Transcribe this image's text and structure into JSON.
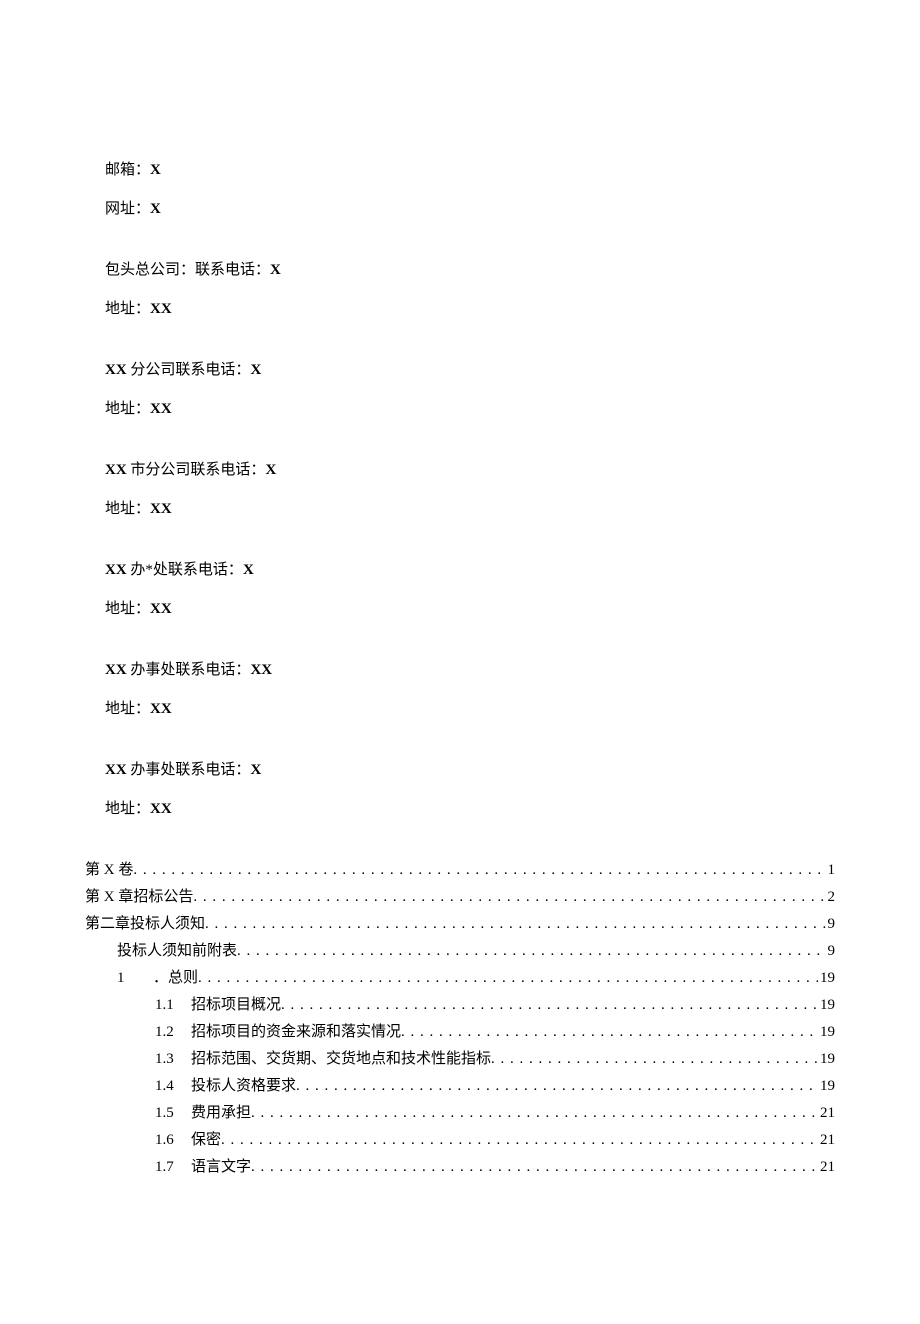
{
  "contact": {
    "email_label": "邮箱：",
    "email_value": "X",
    "website_label": "网址：",
    "website_value": "X",
    "groups": [
      {
        "line1_pre": "包头总公司：联系电话：",
        "line1_val": "X",
        "addr_label": "地址：",
        "addr_val": "XX"
      },
      {
        "line1_pre_bold": "XX",
        "line1_mid": " 分公司联系电话：",
        "line1_val": "X",
        "addr_label": "地址：",
        "addr_val": "XX"
      },
      {
        "line1_pre_bold": "XX",
        "line1_mid": " 市分公司联系电话：",
        "line1_val": "X",
        "addr_label": "地址：",
        "addr_val": "XX"
      },
      {
        "line1_pre_bold": "XX",
        "line1_mid": " 办*处联系电话：",
        "line1_val": "X",
        "addr_label": "地址：",
        "addr_val": "XX"
      },
      {
        "line1_pre_bold": "XX",
        "line1_mid": " 办事处联系电话：",
        "line1_val": "XX",
        "addr_label": "地址：",
        "addr_val": "XX"
      },
      {
        "line1_pre_bold": "XX",
        "line1_mid": " 办事处联系电话：",
        "line1_val": "X",
        "addr_label": "地址：",
        "addr_val": "XX"
      }
    ]
  },
  "toc": [
    {
      "indent": 0,
      "num": "",
      "title": "第 X 卷",
      "page": "1"
    },
    {
      "indent": 0,
      "num": "",
      "title": "第 X 章招标公告",
      "page": "2"
    },
    {
      "indent": 0,
      "num": "",
      "title": "第二章投标人须知",
      "page": "9"
    },
    {
      "indent": 1,
      "num": "",
      "title": "投标人须知前附表",
      "page": "9"
    },
    {
      "indent": 1,
      "num": "1",
      "title": "．总则",
      "page": "19"
    },
    {
      "indent": 2,
      "num": "1.1",
      "title": "招标项目概况",
      "page": "19"
    },
    {
      "indent": 2,
      "num": "1.2",
      "title": "招标项目的资金来源和落实情况",
      "page": "19"
    },
    {
      "indent": 2,
      "num": "1.3",
      "title": "招标范围、交货期、交货地点和技术性能指标",
      "page": "19"
    },
    {
      "indent": 2,
      "num": "1.4",
      "title": "投标人资格要求",
      "page": "19"
    },
    {
      "indent": 2,
      "num": "1.5",
      "title": "费用承担",
      "page": "21"
    },
    {
      "indent": 2,
      "num": "1.6",
      "title": "保密",
      "page": "21"
    },
    {
      "indent": 2,
      "num": "1.7",
      "title": "语言文字",
      "page": "21"
    }
  ]
}
